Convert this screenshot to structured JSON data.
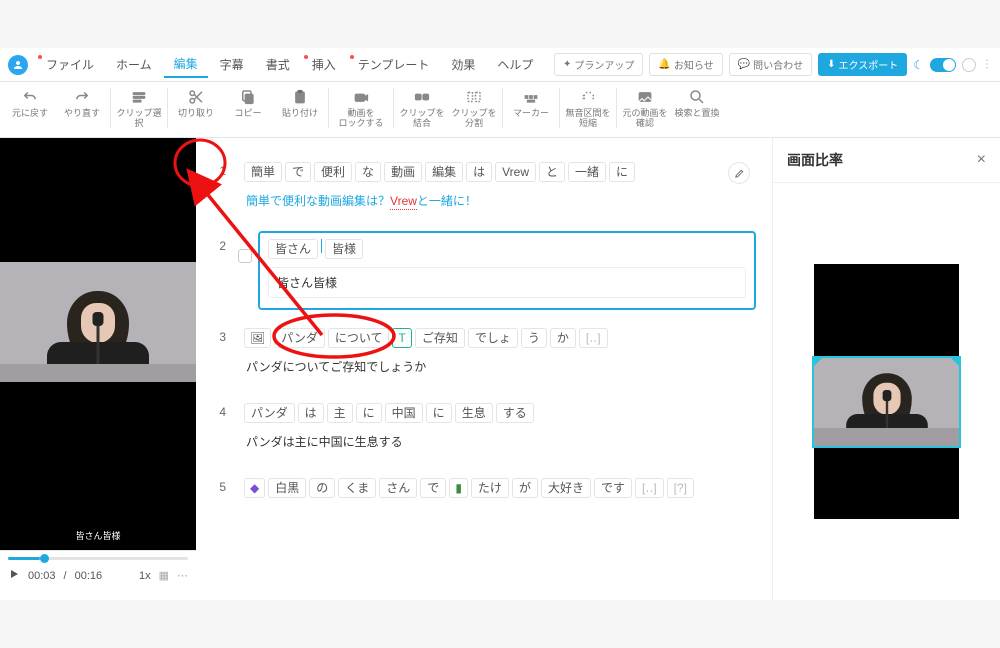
{
  "menu": {
    "items": [
      {
        "label": "ファイル",
        "dot": true
      },
      {
        "label": "ホーム",
        "dot": false
      },
      {
        "label": "編集",
        "dot": false,
        "active": true
      },
      {
        "label": "字幕",
        "dot": false
      },
      {
        "label": "書式",
        "dot": false
      },
      {
        "label": "挿入",
        "dot": true
      },
      {
        "label": "テンプレート",
        "dot": true
      },
      {
        "label": "効果",
        "dot": false
      },
      {
        "label": "ヘルプ",
        "dot": false
      }
    ],
    "right": {
      "plan": "プランアップ",
      "notice": "お知らせ",
      "contact": "問い合わせ",
      "export": "エクスポート"
    }
  },
  "toolbar": {
    "undo": "元に戻す",
    "redo": "やり直す",
    "clip_select": "クリップ選択",
    "cut": "切り取り",
    "copy": "コピー",
    "paste": "貼り付け",
    "lock": "動画を\nロックする",
    "merge": "クリップを\n結合",
    "split": "クリップを\n分割",
    "marker": "マーカー",
    "silence": "無音区間を\n短縮",
    "original": "元の動画を\n確認",
    "replace": "検索と置換"
  },
  "preview": {
    "caption": "皆さん皆様",
    "time_current": "00:03",
    "time_total": "00:16",
    "speed": "1x"
  },
  "clips": [
    {
      "num": "1",
      "chips": [
        "簡単",
        "で",
        "便利",
        "な",
        "動画",
        "編集",
        "は",
        "Vrew",
        "と",
        "一緒",
        "に"
      ],
      "subtitle_pre": "簡単で便利な動画編集は？",
      "subtitle_red": "Vrew",
      "subtitle_post": "と一緒に！",
      "link": true
    },
    {
      "num": "2",
      "chips": [
        "皆さん",
        "皆様"
      ],
      "subtitle": "皆さん皆様",
      "selected": true
    },
    {
      "num": "3",
      "chips": [
        "パンダ",
        "について",
        "ご存知",
        "でしょ",
        "う",
        "か"
      ],
      "subtitle": "パンダについてご存知でしょうか"
    },
    {
      "num": "4",
      "chips": [
        "パンダ",
        "は",
        "主",
        "に",
        "中国",
        "に",
        "生息",
        "する"
      ],
      "subtitle": "パンダは主に中国に生息する"
    },
    {
      "num": "5",
      "chips": [
        "白黒",
        "の",
        "くま",
        "さん",
        "で",
        "たけ",
        "が",
        "大好き",
        "です"
      ],
      "brack1": "[‥]",
      "brack2": "[?]"
    }
  ],
  "side": {
    "title": "画面比率"
  }
}
